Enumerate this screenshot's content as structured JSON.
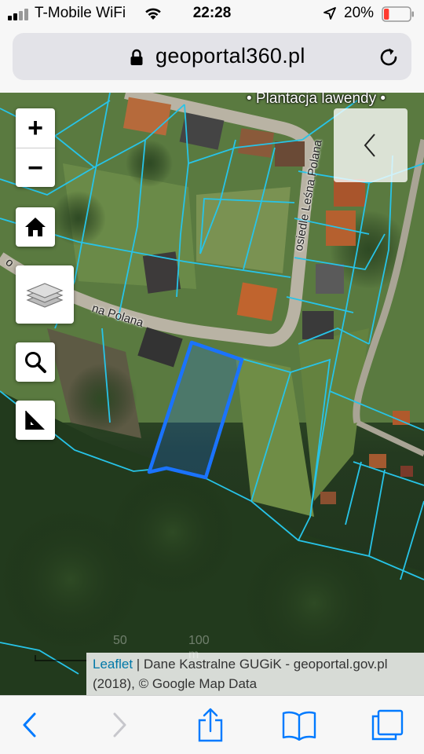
{
  "status_bar": {
    "carrier": "T-Mobile WiFi",
    "time": "22:28",
    "battery_percent": "20%",
    "battery_level": 0.2,
    "battery_color": "#ff3b30"
  },
  "browser": {
    "url": "geoportal360.pl"
  },
  "map": {
    "labels": {
      "plantacja": "• Plantacja lawendy •",
      "osiedle": "osiedle Leśna Polana",
      "polana": "na Polana",
      "partial_o": "o"
    },
    "controls": {
      "zoom_in": "+",
      "zoom_out": "−"
    },
    "scale": {
      "left_label": "50",
      "right_label": "100 m"
    },
    "attribution": {
      "leaflet": "Leaflet",
      "line1": " | Dane Kastralne GUGiK - geoportal.gov.pl",
      "line2": "(2018), © Google Map Data"
    },
    "colors": {
      "parcel_lines": "#27c4e8",
      "selected_parcel": "#1a73ff",
      "accent": "#007aff"
    }
  }
}
